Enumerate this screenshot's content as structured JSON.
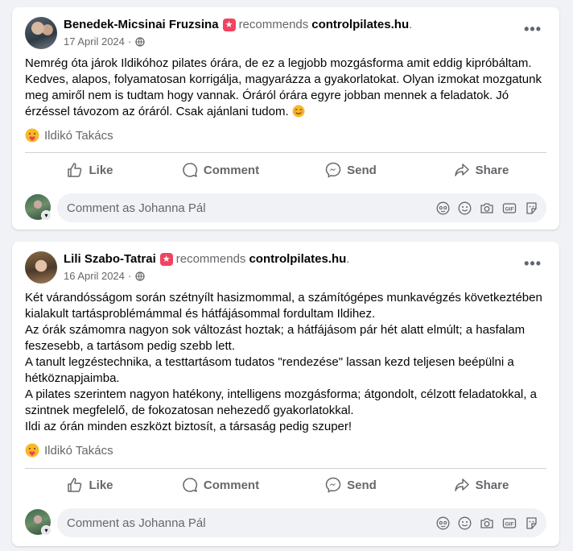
{
  "posts": [
    {
      "author": "Benedek-Micsinai Fruzsina",
      "recommends": "recommends",
      "page": "controlpilates.hu",
      "dot": ".",
      "date": "17 April 2024",
      "privacy": "·",
      "text": "Nemrég óta járok Ildikóhoz pilates órára, de ez a legjobb mozgásforma amit eddig kipróbáltam. Kedves, alapos, folyamatosan korrigálja, magyarázza a gyakorlatokat. Olyan izmokat mozgatunk meg amiről nem is tudtam hogy vannak. Óráról  órára egyre jobban mennek a feladatok. Jó érzéssel távozom az óráról. Csak ajánlani tudom.",
      "reactor": "Ildikó Takács"
    },
    {
      "author": "Lili Szabo-Tatrai",
      "recommends": "recommends",
      "page": "controlpilates.hu",
      "dot": ".",
      "date": "16 April 2024",
      "privacy": "·",
      "text": "Két várandósságom során szétnyílt hasizmommal, a számítógépes munkavégzés következtében kialakult tartásproblémámmal és hátfájásommal fordultam Ildihez.\nAz órák számomra nagyon sok változást hoztak; a hátfájásom pár hét alatt elmúlt; a hasfalam feszesebb, a tartásom pedig szebb lett.\nA tanult legzéstechnika, a testtartásom tudatos \"rendezése\" lassan kezd teljesen beépülni a hétköznapjaimba.\nA pilates szerintem nagyon hatékony, intelligens mozgásforma; átgondolt, célzott feladatokkal, a szintnek megfelelő, de fokozatosan nehezedő gyakorlatokkal.\nIldi az órán minden eszközt biztosít, a társaság pedig szuper!",
      "reactor": "Ildikó Takács"
    }
  ],
  "actions": {
    "like": "Like",
    "comment": "Comment",
    "send": "Send",
    "share": "Share"
  },
  "comment_placeholder": "Comment as Johanna Pál",
  "colors": {
    "recommend_badge": "#f3425f",
    "secondary_text": "#65676b",
    "background": "#f0f2f5"
  }
}
